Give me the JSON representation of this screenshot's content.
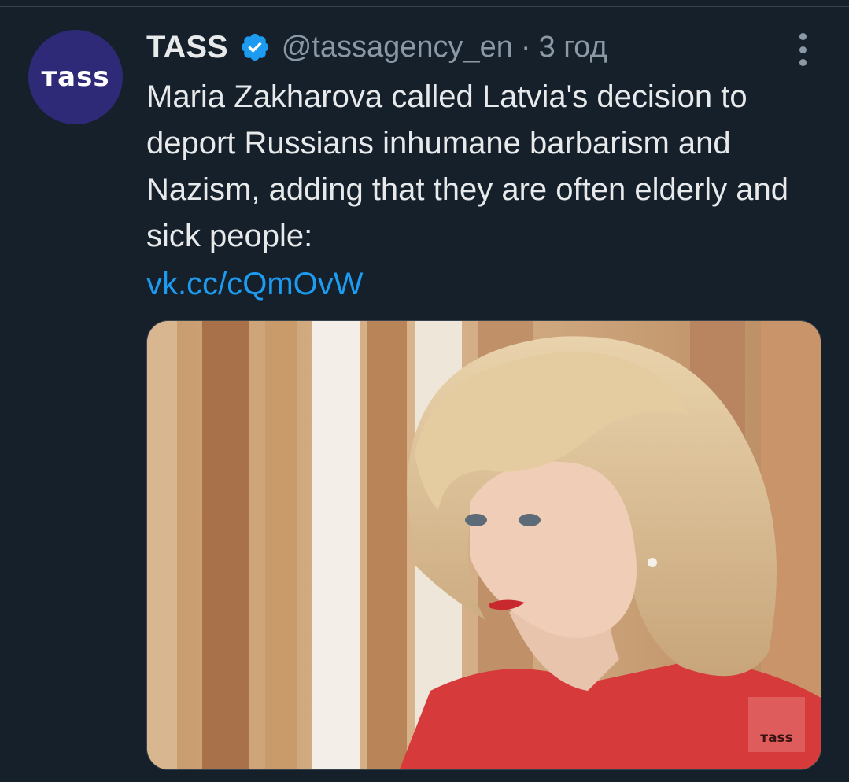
{
  "tweet": {
    "avatar": {
      "text": "тass",
      "background": "#2e2a78"
    },
    "author_name": "TASS",
    "verified_icon": "verified-badge-icon",
    "verified_color": "#1d9bf0",
    "handle": "@tassagency_en",
    "separator": "·",
    "time": "3 год",
    "more_icon": "more-options-icon",
    "text": "Maria Zakharova called Latvia's decision to deport Russians inhumane barbarism and Nazism, adding that they are often elderly and sick people:",
    "link": "vk.cc/cQmOvW",
    "media": {
      "description_icon": "photo",
      "watermark": "тass"
    }
  },
  "colors": {
    "background": "#15202b",
    "primary_text": "#e7e9ea",
    "secondary_text": "#8b98a5",
    "link": "#1d9bf0"
  }
}
